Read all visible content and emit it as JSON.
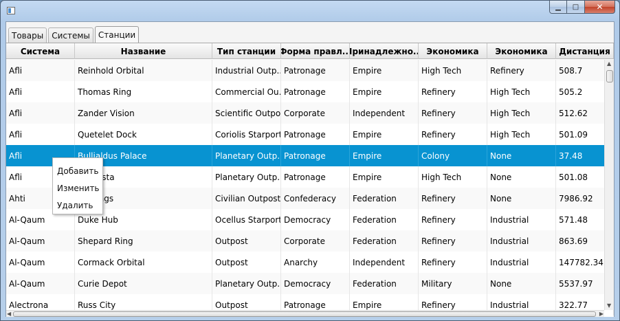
{
  "window": {
    "title": ""
  },
  "caption_buttons": {
    "minimize": "▁",
    "maximize": "□",
    "close": "✕"
  },
  "tabs": [
    {
      "label": "Товары",
      "active": false
    },
    {
      "label": "Системы",
      "active": false
    },
    {
      "label": "Станции",
      "active": true
    }
  ],
  "table": {
    "columns": [
      "Система",
      "Название",
      "Тип станции",
      "Форма правл...",
      "Принадлежно...",
      "Экономика",
      "Экономика",
      "Дистанция"
    ],
    "rows": [
      [
        "Afli",
        "Reinhold Orbital",
        "Industrial Outp...",
        "Patronage",
        "Empire",
        "High Tech",
        "Refinery",
        "508.7"
      ],
      [
        "Afli",
        "Thomas Ring",
        "Commercial Ou...",
        "Patronage",
        "Empire",
        "Refinery",
        "High Tech",
        "505.2"
      ],
      [
        "Afli",
        "Zander Vision",
        "Scientific Outpost",
        "Corporate",
        "Independent",
        "Refinery",
        "High Tech",
        "512.62"
      ],
      [
        "Afli",
        "Quetelet Dock",
        "Coriolis Starport",
        "Patronage",
        "Empire",
        "Refinery",
        "High Tech",
        "501.09"
      ],
      [
        "Afli",
        "Bullialdus Palace",
        "Planetary Outp...",
        "Patronage",
        "Empire",
        "Colony",
        "None",
        "37.48"
      ],
      [
        "Afli",
        "rup Vista",
        "Planetary Outp...",
        "Patronage",
        "Empire",
        "High Tech",
        "None",
        "501.08"
      ],
      [
        "Ahti",
        "Holdings",
        "Civilian Outpost",
        "Confederacy",
        "Federation",
        "Refinery",
        "None",
        "7986.92"
      ],
      [
        "Al-Qaum",
        "Duke Hub",
        "Ocellus Starport",
        "Democracy",
        "Federation",
        "Refinery",
        "Industrial",
        "571.48"
      ],
      [
        "Al-Qaum",
        "Shepard Ring",
        "Outpost",
        "Corporate",
        "Federation",
        "Refinery",
        "Industrial",
        "863.69"
      ],
      [
        "Al-Qaum",
        "Cormack Orbital",
        "Outpost",
        "Anarchy",
        "Independent",
        "Refinery",
        "Industrial",
        "147782.34"
      ],
      [
        "Al-Qaum",
        "Curie Depot",
        "Planetary Outp...",
        "Democracy",
        "Federation",
        "Military",
        "None",
        "5537.97"
      ],
      [
        "Alectrona",
        "Russ City",
        "Outpost",
        "Patronage",
        "Empire",
        "Refinery",
        "Industrial",
        "322.77"
      ]
    ],
    "selected_row": 4
  },
  "context_menu": {
    "items": [
      "Добавить",
      "Изменить",
      "Удалить"
    ]
  },
  "colors": {
    "selection": "#0893d1",
    "titlebar": "#b6cfea"
  }
}
